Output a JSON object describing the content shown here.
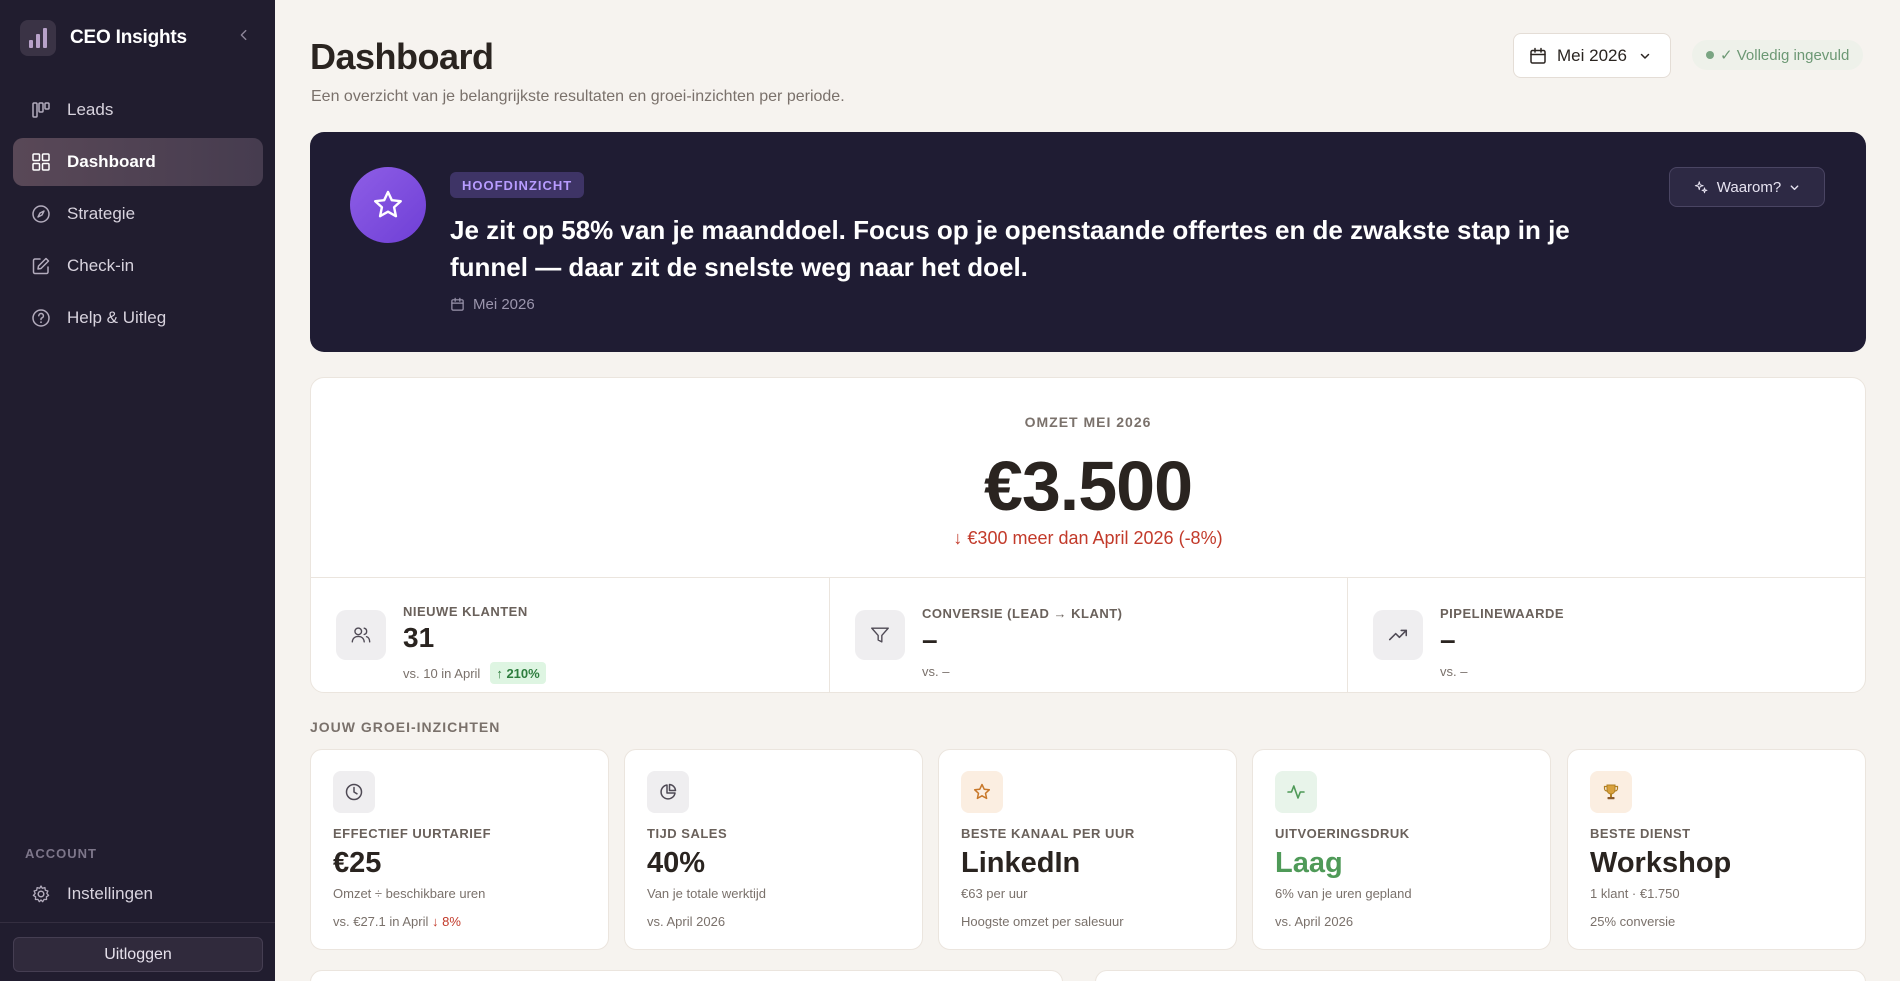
{
  "sidebar": {
    "brand": "CEO Insights",
    "items": [
      {
        "label": "Leads",
        "icon": "kanban-icon"
      },
      {
        "label": "Dashboard",
        "icon": "grid-icon"
      },
      {
        "label": "Strategie",
        "icon": "compass-icon"
      },
      {
        "label": "Check-in",
        "icon": "edit-icon"
      },
      {
        "label": "Help & Uitleg",
        "icon": "help-circle-icon"
      }
    ],
    "active_index": 1,
    "account_label": "ACCOUNT",
    "settings_label": "Instellingen",
    "logout_label": "Uitloggen"
  },
  "header": {
    "title": "Dashboard",
    "subtitle": "Een overzicht van je belangrijkste resultaten en groei-inzichten per periode.",
    "period": "Mei 2026",
    "status": "✓ Volledig ingevuld"
  },
  "hero": {
    "tag": "HOOFDINZICHT",
    "text": "Je zit op 58% van je maanddoel. Focus op je openstaande offertes en de zwakste stap in je funnel — daar zit de snelste weg naar het doel.",
    "date": "Mei 2026",
    "why_label": "Waarom?"
  },
  "revenue": {
    "label": "OMZET MEI 2026",
    "value": "€3.500",
    "delta": "↓ €300 meer dan April 2026 (-8%)"
  },
  "kpis": [
    {
      "label": "NIEUWE KLANTEN",
      "value": "31",
      "sub": "vs. 10 in April",
      "badge": "↑ 210%"
    },
    {
      "label": "CONVERSIE (LEAD → KLANT)",
      "value": "–",
      "sub": "vs. –"
    },
    {
      "label": "PIPELINEWAARDE",
      "value": "–",
      "sub": "vs. –"
    }
  ],
  "growth": {
    "title": "JOUW GROEI-INZICHTEN",
    "cards": [
      {
        "label": "EFFECTIEF UURTARIEF",
        "value": "€25",
        "desc": "Omzet ÷ beschikbare uren",
        "foot": "vs. €27.1 in April",
        "foot_neg": "↓ 8%"
      },
      {
        "label": "TIJD SALES",
        "value": "40%",
        "desc": "Van je totale werktijd",
        "foot": "vs. April 2026"
      },
      {
        "label": "BESTE KANAAL PER UUR",
        "value": "LinkedIn",
        "desc": "€63 per uur",
        "foot": "Hoogste omzet per salesuur"
      },
      {
        "label": "UITVOERINGSDRUK",
        "value": "Laag",
        "desc": "6% van je uren gepland",
        "foot": "vs. April 2026"
      },
      {
        "label": "BESTE DIENST",
        "value": "Workshop",
        "desc": "1 klant · €1.750",
        "foot": "25% conversie"
      }
    ]
  },
  "colors": {
    "sidebar_bg": "#211d2f",
    "hero_bg": "#1f1c33",
    "accent_purple": "#7c4ddf",
    "negative": "#c23a2a",
    "positive": "#2e7d3e",
    "label_low": "#4f9a58"
  }
}
